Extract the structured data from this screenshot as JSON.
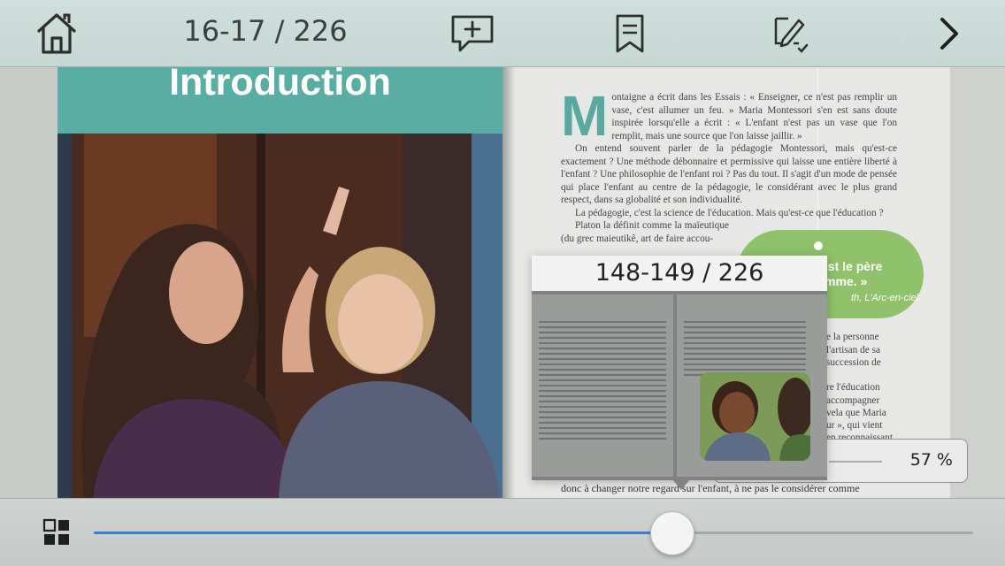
{
  "toolbar": {
    "page_counter": "16-17 / 226",
    "icons": {
      "home": "home-icon",
      "add_note": "add-comment-icon",
      "bookmark": "bookmark-icon",
      "annotate": "annotation-icon",
      "next": "chevron-right-icon"
    }
  },
  "left_page": {
    "title": "Introduction",
    "band_color": "#5aada4"
  },
  "right_page": {
    "dropcap": "M",
    "paragraphs": [
      "ontaigne a écrit dans les Essais : « Enseigner, ce n'est pas remplir un vase, c'est allumer un feu. » Maria Montessori s'en est sans doute inspirée lorsqu'elle a écrit : « L'enfant n'est pas un vase que l'on remplit, mais une source que l'on laisse jaillir. »",
      "On entend souvent parler de la pédagogie Montessori, mais qu'est-ce exactement ? Une méthode débonnaire et permissive qui laisse une entière liberté à l'enfant ? Une philosophie de l'enfant roi ? Pas du tout. Il s'agit d'un mode de pensée qui place l'enfant au centre de la pédagogie, le considérant avec le plus grand respect, dans sa globalité et son individualité.",
      "La pédagogie, c'est la science de l'éducation. Mais qu'est-ce que l'éducation ?",
      "Platon la définit comme la maïeutique (du grec maieutikê, art de faire accou-"
    ],
    "quote": {
      "line1": "est le père",
      "line2": "mme. »",
      "line3": "th, L'Arc-en-ciel."
    },
    "fragments": [
      "e la personne",
      "l'artisan de sa",
      "succession de",
      "re l'éducation",
      "accompagner",
      "vela que Maria",
      "ur », qui vient",
      "en reconnaissant"
    ],
    "bottom_line": "donc à changer notre regard sur l'enfant, à ne pas le considérer comme"
  },
  "preview": {
    "page_label": "148-149 / 226"
  },
  "progress": {
    "percent_label": "57 %",
    "fraction": 0.657
  },
  "bottombar": {
    "thumbnails_icon": "grid-thumbnails-icon",
    "accent": "#3a7fd5"
  }
}
